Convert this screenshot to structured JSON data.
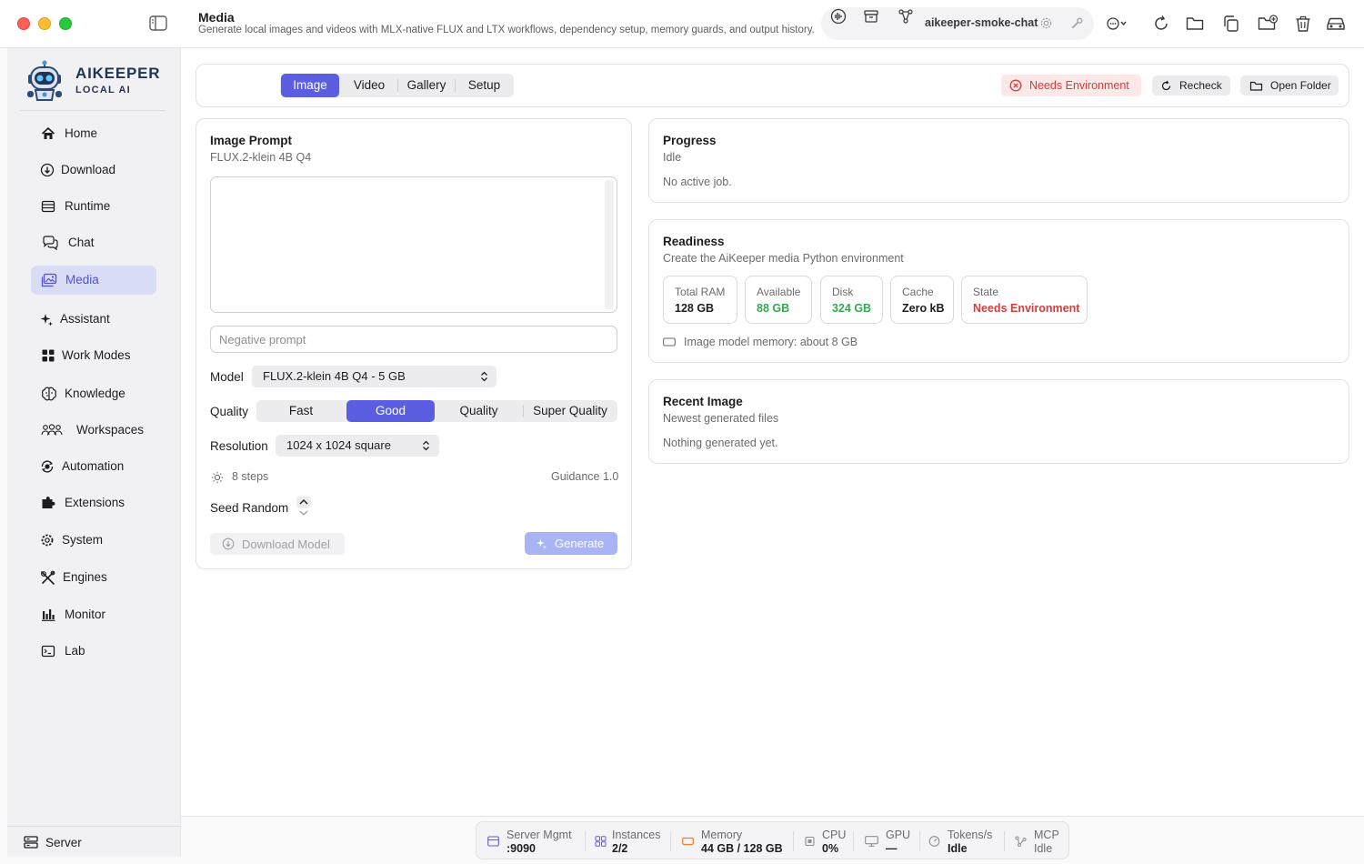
{
  "header": {
    "title": "Media",
    "subtitle": "Generate local images and videos with MLX-native FLUX and LTX workflows, dependency setup, memory guards, and output history.",
    "profile_name": "aikeeper-smoke-chat",
    "toolbar_icons": [
      "waveform-icon",
      "archive-icon",
      "network-icon",
      "gear-icon",
      "wrench-icon",
      "more-menu-icon",
      "refresh-icon",
      "folder-icon",
      "copy-icon",
      "folder-plus-icon",
      "trash-icon",
      "car-icon"
    ]
  },
  "brand": {
    "name": "AIKEEPER",
    "tagline": "LOCAL AI"
  },
  "sidebar": {
    "items": [
      {
        "label": "Home",
        "icon": "house-icon"
      },
      {
        "label": "Download",
        "icon": "download-icon"
      },
      {
        "label": "Runtime",
        "icon": "runtime-icon"
      },
      {
        "label": "Chat",
        "icon": "chat-icon"
      },
      {
        "label": "Media",
        "icon": "photo-icon",
        "active": true
      },
      {
        "label": "Assistant",
        "icon": "sparkle-icon"
      },
      {
        "label": "Work Modes",
        "icon": "grid-icon"
      },
      {
        "label": "Knowledge",
        "icon": "brain-icon"
      },
      {
        "label": "Workspaces",
        "icon": "people-icon"
      },
      {
        "label": "Automation",
        "icon": "automation-icon"
      },
      {
        "label": "Extensions",
        "icon": "puzzle-icon"
      },
      {
        "label": "System",
        "icon": "gear-icon"
      },
      {
        "label": "Engines",
        "icon": "tools-icon"
      },
      {
        "label": "Monitor",
        "icon": "chart-icon"
      },
      {
        "label": "Lab",
        "icon": "terminal-icon"
      }
    ],
    "footer": {
      "label": "Server",
      "icon": "server-icon"
    }
  },
  "tabs": [
    {
      "label": "Image",
      "active": true
    },
    {
      "label": "Video"
    },
    {
      "label": "Gallery"
    },
    {
      "label": "Setup"
    }
  ],
  "top_actions": {
    "status": "Needs Environment",
    "recheck": "Recheck",
    "open_folder": "Open Folder"
  },
  "image_prompt": {
    "title": "Image Prompt",
    "model_name": "FLUX.2-klein 4B Q4",
    "prompt_value": "",
    "negative_placeholder": "Negative prompt",
    "model_label": "Model",
    "model_selected": "FLUX.2-klein 4B Q4 - 5 GB",
    "quality_label": "Quality",
    "quality_options": [
      "Fast",
      "Good",
      "Quality",
      "Super Quality"
    ],
    "quality_selected": "Good",
    "resolution_label": "Resolution",
    "resolution_selected": "1024 x 1024 square",
    "steps": "8 steps",
    "guidance": "Guidance 1.0",
    "seed": "Seed Random",
    "download_button": "Download Model",
    "generate_button": "Generate"
  },
  "progress": {
    "title": "Progress",
    "status": "Idle",
    "message": "No active job."
  },
  "readiness": {
    "title": "Readiness",
    "subtitle": "Create the AiKeeper media Python environment",
    "stats": [
      {
        "label": "Total RAM",
        "value": "128 GB",
        "color": "#1d1d1f"
      },
      {
        "label": "Available",
        "value": "88 GB",
        "color": "#34a853"
      },
      {
        "label": "Disk",
        "value": "324 GB",
        "color": "#34a853"
      },
      {
        "label": "Cache",
        "value": "Zero kB",
        "color": "#1d1d1f"
      },
      {
        "label": "State",
        "value": "Needs Environment",
        "color": "#d93a3a"
      }
    ],
    "memory_note": "Image model memory: about 8 GB"
  },
  "recent_image": {
    "title": "Recent Image",
    "subtitle": "Newest generated files",
    "message": "Nothing generated yet."
  },
  "statusbar": [
    {
      "label": "Server Mgmt",
      "value": ":9090",
      "icon": "server-icon"
    },
    {
      "label": "Instances",
      "value": "2/2",
      "icon": "grid-icon"
    },
    {
      "label": "Memory",
      "value": "44 GB / 128 GB",
      "icon": "memory-icon"
    },
    {
      "label": "CPU",
      "value": "0%",
      "icon": "cpu-icon"
    },
    {
      "label": "GPU",
      "value": "—",
      "icon": "display-icon"
    },
    {
      "label": "Tokens/s",
      "value": "Idle",
      "icon": "gauge-icon"
    },
    {
      "label": "MCP",
      "value": "Idle",
      "icon": "network-icon"
    }
  ],
  "colors": {
    "accent": "#5b5ee1",
    "sidebar_active_bg": "#d9dcf5",
    "danger": "#d93a3a",
    "success": "#34a853"
  }
}
